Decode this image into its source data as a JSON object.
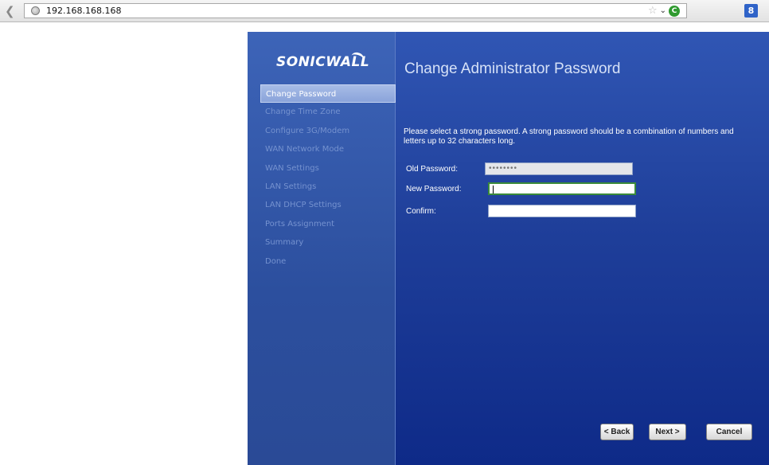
{
  "browser": {
    "url": "192.168.168.168",
    "extension_label": "8"
  },
  "wizard": {
    "logo_text": "SONICWALL",
    "nav_items": [
      {
        "label": "Change Password",
        "active": true
      },
      {
        "label": "Change Time Zone",
        "active": false
      },
      {
        "label": "Configure 3G/Modem",
        "active": false
      },
      {
        "label": "WAN Network Mode",
        "active": false
      },
      {
        "label": "WAN Settings",
        "active": false
      },
      {
        "label": "LAN Settings",
        "active": false
      },
      {
        "label": "LAN DHCP Settings",
        "active": false
      },
      {
        "label": "Ports Assignment",
        "active": false
      },
      {
        "label": "Summary",
        "active": false
      },
      {
        "label": "Done",
        "active": false
      }
    ],
    "title": "Change Administrator Password",
    "description": "Please select a strong password. A strong password should be a combination of numbers and letters up to 32 characters long.",
    "fields": {
      "old_password_label": "Old Password:",
      "old_password_value": "••••••••",
      "new_password_label": "New Password:",
      "new_password_value": "",
      "confirm_label": "Confirm:",
      "confirm_value": ""
    },
    "buttons": {
      "back": "< Back",
      "next": "Next >",
      "cancel": "Cancel"
    }
  },
  "colors": {
    "sidebar_bg": "#2c4f9e",
    "main_bg": "#1f3f9a",
    "active_nav": "#8aa3da",
    "inactive_nav_text": "#7592cf"
  }
}
